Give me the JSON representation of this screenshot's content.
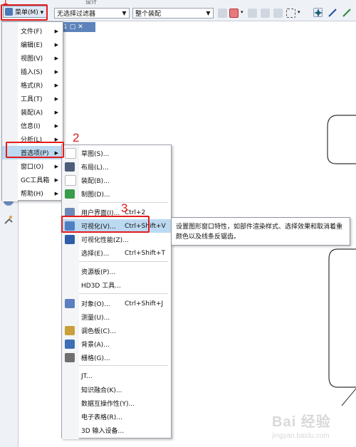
{
  "toolbar": {
    "menu_label": "菜单(M) ▾",
    "top_partial": "设计",
    "filter_select": "无选择过滤器",
    "assembly_select": "整个装配"
  },
  "tab": {
    "label": "1"
  },
  "main_menu": [
    {
      "label": "文件(F)",
      "has_sub": true
    },
    {
      "label": "编辑(E)",
      "has_sub": true
    },
    {
      "label": "视图(V)",
      "has_sub": true
    },
    {
      "label": "插入(S)",
      "has_sub": true
    },
    {
      "label": "格式(R)",
      "has_sub": true
    },
    {
      "label": "工具(T)",
      "has_sub": true
    },
    {
      "label": "装配(A)",
      "has_sub": true
    },
    {
      "label": "信息(I)",
      "has_sub": true
    },
    {
      "label": "分析(L)",
      "has_sub": true
    },
    {
      "label": "首选项(P)",
      "has_sub": true,
      "highlighted": true
    },
    {
      "label": "窗口(O)",
      "has_sub": true
    },
    {
      "label": "GC工具箱",
      "has_sub": true
    },
    {
      "label": "帮助(H)",
      "has_sub": true
    }
  ],
  "sub_menu": [
    {
      "label": "草图(S)...",
      "icon": "sketch-icon"
    },
    {
      "label": "布局(L)...",
      "icon": "layout-icon"
    },
    {
      "label": "装配(B)...",
      "icon": "assembly-icon"
    },
    {
      "label": "制图(D)...",
      "icon": "drafting-icon"
    },
    {
      "label": "用户界面(I)...",
      "shortcut": "Ctrl+2",
      "icon": "user-interface-icon"
    },
    {
      "label": "可视化(V)...",
      "shortcut": "Ctrl+Shift+V",
      "icon": "visualization-icon",
      "highlighted": true
    },
    {
      "label": "可视化性能(Z)...",
      "icon": "visualization-performance-icon"
    },
    {
      "label": "选择(E)...",
      "shortcut": "Ctrl+Shift+T",
      "icon": ""
    },
    {
      "label": "资源板(P)...",
      "icon": ""
    },
    {
      "label": "HD3D 工具...",
      "icon": ""
    },
    {
      "label": "对象(O)...",
      "shortcut": "Ctrl+Shift+J",
      "icon": "object-icon"
    },
    {
      "label": "测量(U)...",
      "icon": ""
    },
    {
      "label": "调色板(C)...",
      "icon": "palette-icon"
    },
    {
      "label": "背景(A)...",
      "icon": "background-icon"
    },
    {
      "label": "栅格(G)...",
      "icon": "grid-icon"
    },
    {
      "label": "JT...",
      "icon": ""
    },
    {
      "label": "知识融合(K)...",
      "icon": ""
    },
    {
      "label": "数据互操作性(Y)...",
      "icon": ""
    },
    {
      "label": "电子表格(R)...",
      "icon": ""
    },
    {
      "label": "3D 输入设备...",
      "icon": ""
    }
  ],
  "tooltip": {
    "text": "设置图形窗口特性，如部件渲染样式、选择效果和取消着重颜色以及线条反锯齿。"
  },
  "step_labels": {
    "one": "1",
    "two": "2",
    "three": "3"
  },
  "watermark": {
    "brand": "Bai 经验",
    "url": "jingyan.baidu.com"
  },
  "colors": {
    "accent": "#5d83ba",
    "highlight": "#bcd9f2",
    "annotation": "#e31c1c"
  }
}
